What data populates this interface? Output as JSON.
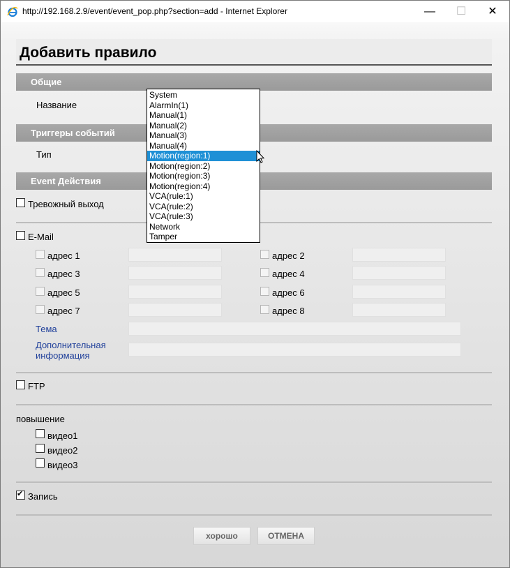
{
  "window": {
    "title": "http://192.168.2.9/event/event_pop.php?section=add - Internet Explorer",
    "minimize_glyph": "—",
    "maximize_glyph": "☐",
    "close_glyph": "✕"
  },
  "page": {
    "heading": "Добавить правило"
  },
  "sections": {
    "general": "Общие",
    "triggers": "Триггеры событий",
    "actions": "Event Действия"
  },
  "general": {
    "name_label": "Название"
  },
  "trigger": {
    "type_label": "Тип"
  },
  "dropdown": {
    "options": [
      "System",
      "AlarmIn(1)",
      "Manual(1)",
      "Manual(2)",
      "Manual(3)",
      "Manual(4)",
      "Motion(region:1)",
      "Motion(region:2)",
      "Motion(region:3)",
      "Motion(region:4)",
      "VCA(rule:1)",
      "VCA(rule:2)",
      "VCA(rule:3)",
      "Network",
      "Tamper"
    ],
    "selected_index": 6
  },
  "actions": {
    "alarm_out": "Тревожный выход",
    "email": "E-Mail",
    "addresses": [
      "адрес 1",
      "адрес 2",
      "адрес 3",
      "адрес 4",
      "адрес 5",
      "адрес 6",
      "адрес 7",
      "адрес 8"
    ],
    "subject": "Тема",
    "extra_info_line1": "Дополнительная",
    "extra_info_line2": "информация",
    "ftp": "FTP",
    "upload": "повышение",
    "videos": [
      "видео1",
      "видео2",
      "видео3"
    ],
    "record": "Запись",
    "record_checked": true
  },
  "buttons": {
    "ok": "хорошо",
    "cancel": "ОТМЕНА"
  },
  "colors": {
    "selection": "#1e90d6",
    "section_bar": "#a0a0a0",
    "link_blue": "#1f3f9a"
  }
}
